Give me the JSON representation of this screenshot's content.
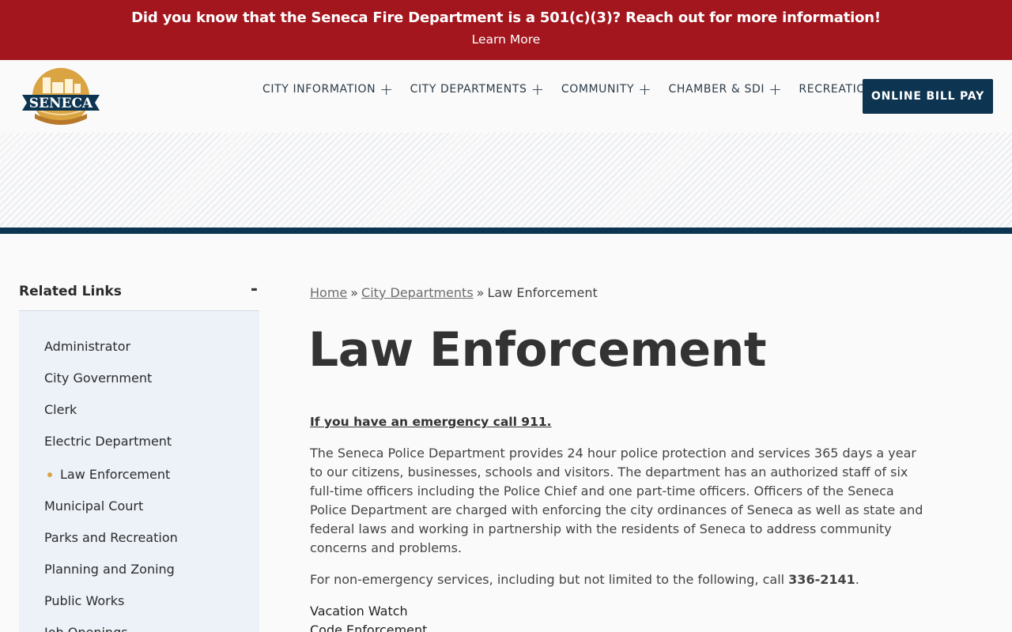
{
  "alert": {
    "message": "Did you know that the Seneca Fire Department is a 501(c)(3)? Reach out for more information!",
    "link_label": "Learn More"
  },
  "header": {
    "logo_text": "SENECA",
    "nav": [
      {
        "label": "CITY INFORMATION",
        "has_submenu": true
      },
      {
        "label": "CITY DEPARTMENTS",
        "has_submenu": true
      },
      {
        "label": "COMMUNITY",
        "has_submenu": true
      },
      {
        "label": "CHAMBER & SDI",
        "has_submenu": true
      },
      {
        "label": "RECREATION",
        "has_submenu": false
      }
    ],
    "nav_plus": "+",
    "bill_pay_label": "ONLINE BILL PAY"
  },
  "sidebar": {
    "title": "Related Links",
    "toggle": "-",
    "items": [
      {
        "label": "Administrator",
        "active": false
      },
      {
        "label": "City Government",
        "active": false
      },
      {
        "label": "Clerk",
        "active": false
      },
      {
        "label": "Electric Department",
        "active": false
      },
      {
        "label": "Law Enforcement",
        "active": true
      },
      {
        "label": "Municipal Court",
        "active": false
      },
      {
        "label": "Parks and Recreation",
        "active": false
      },
      {
        "label": "Planning and Zoning",
        "active": false
      },
      {
        "label": "Public Works",
        "active": false
      },
      {
        "label": "Job Openings",
        "active": false
      }
    ]
  },
  "breadcrumb": {
    "home": "Home",
    "separator": "»",
    "section": "City Departments",
    "current": "Law Enforcement"
  },
  "main": {
    "title": "Law Enforcement",
    "emergency": "If you have an emergency call 911.",
    "description": "The Seneca Police Department provides 24 hour police protection and services 365 days a year to our citizens, businesses, schools and visitors.  The department has an authorized staff of six full-time officers including the Police Chief and one part-time officers.  Officers of the Seneca Police Department are charged with enforcing the city ordinances of Seneca as well as state and federal laws and working in partnership with the residents of Seneca to address community concerns and problems.",
    "non_emergency_prefix": "For non-emergency services, including but not limited to the following, call ",
    "non_emergency_number": "336-2141",
    "non_emergency_suffix": ".",
    "services": [
      "Vacation Watch",
      "Code Enforcement"
    ]
  },
  "colors": {
    "alert_bg": "#a3161e",
    "navy": "#0d3451",
    "sidebar_bg": "#edf2f9",
    "active_dot": "#d9a441"
  }
}
